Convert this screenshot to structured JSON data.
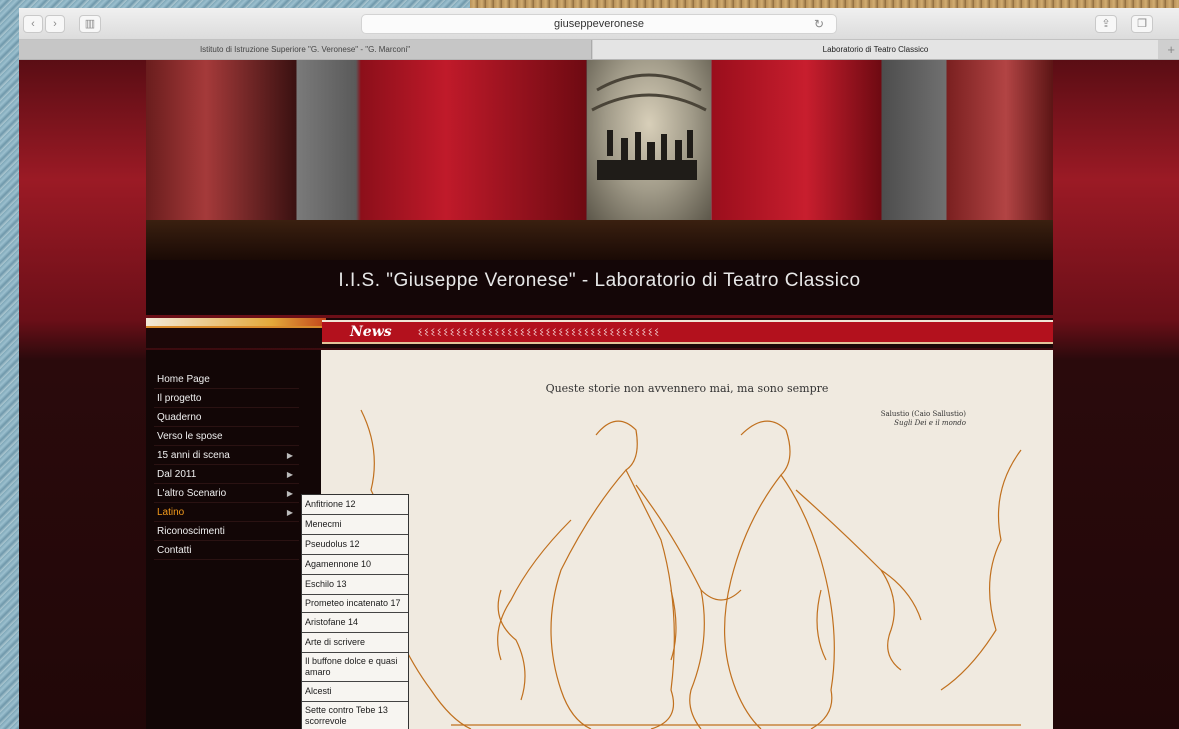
{
  "browser": {
    "url": "giuseppeveronese",
    "tabs": [
      {
        "label": "Istituto di Istruzione Superiore \"G. Veronese\" - \"G. Marconi\""
      },
      {
        "label": "Laboratorio di Teatro Classico"
      }
    ],
    "toolbar": {
      "back_icon": "chevron-left-icon",
      "forward_icon": "chevron-right-icon",
      "reader_icon": "sidebar-icon",
      "share_icon": "share-icon",
      "tabs_icon": "tabs-icon",
      "reload_icon": "reload-icon",
      "back_glyph": "‹",
      "forward_glyph": "›",
      "reader_glyph": "▥",
      "reload_glyph": "↻",
      "share_glyph": "⇪",
      "tabs_glyph": "❐",
      "add_tab_glyph": "+"
    }
  },
  "site": {
    "title": "I.I.S. \"Giuseppe Veronese\"  -  Laboratorio di Teatro Classico",
    "news_label": "News",
    "news_ticker": "ଽଽଽଽଽଽଽଽଽଽଽଽଽଽଽଽଽଽଽଽଽଽଽଽଽଽଽଽଽଽଽଽଽଽଽଽଽଽ"
  },
  "menu": {
    "items": [
      {
        "label": "Home Page",
        "has_submenu": false,
        "active": false
      },
      {
        "label": "Il progetto",
        "has_submenu": false,
        "active": false
      },
      {
        "label": "Quaderno",
        "has_submenu": false,
        "active": false
      },
      {
        "label": "Verso le spose",
        "has_submenu": false,
        "active": false
      },
      {
        "label": "15 anni di scena",
        "has_submenu": true,
        "active": false
      },
      {
        "label": "Dal 2011",
        "has_submenu": true,
        "active": false
      },
      {
        "label": "L'altro Scenario",
        "has_submenu": true,
        "active": false
      },
      {
        "label": "Latino",
        "has_submenu": true,
        "active": true
      },
      {
        "label": "Riconoscimenti",
        "has_submenu": false,
        "active": false
      },
      {
        "label": "Contatti",
        "has_submenu": false,
        "active": false
      }
    ],
    "submenu": [
      "Anfitrione 12",
      "Menecmi",
      "Pseudolus 12",
      "Agamennone 10",
      "Eschilo 13",
      "Prometeo incatenato 17",
      "Aristofane 14",
      "Arte di scrivere",
      "Il buffone dolce e quasi amaro",
      "Alcesti",
      "Sette contro Tebe 13 scorrevole"
    ]
  },
  "content": {
    "quote": "Queste storie non avvennero mai, ma sono sempre",
    "attribution_author": "Salustio (Caio Sallustio)",
    "attribution_work": "Sugli Dei e il mondo"
  },
  "colors": {
    "page_red": "#9b1a25",
    "news_red": "#b3111d",
    "accent_orange": "#f29a1c",
    "illustration_stroke": "#c0701e",
    "content_bg": "#f0eae0"
  }
}
